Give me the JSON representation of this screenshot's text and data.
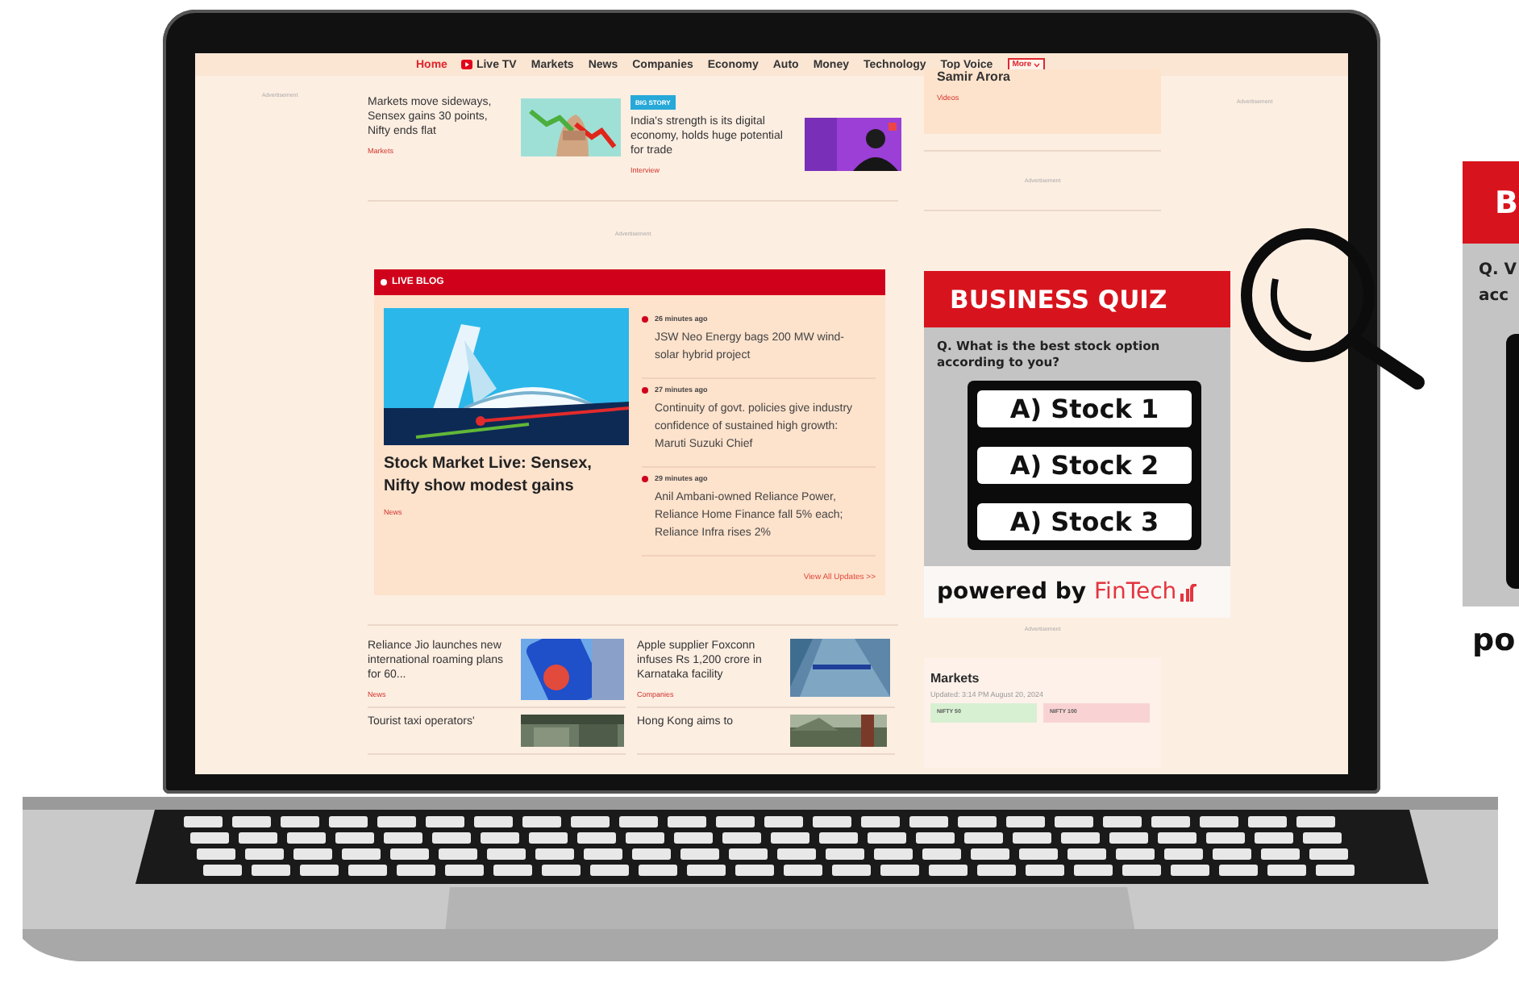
{
  "nav": {
    "items": [
      {
        "label": "Home",
        "selected": true,
        "kind": "text"
      },
      {
        "label": "Live TV",
        "selected": false,
        "kind": "live"
      },
      {
        "label": "Markets",
        "selected": false,
        "kind": "text"
      },
      {
        "label": "News",
        "selected": false,
        "kind": "text"
      },
      {
        "label": "Companies",
        "selected": false,
        "kind": "text"
      },
      {
        "label": "Economy",
        "selected": false,
        "kind": "text"
      },
      {
        "label": "Auto",
        "selected": false,
        "kind": "text"
      },
      {
        "label": "Money",
        "selected": false,
        "kind": "text"
      },
      {
        "label": "Technology",
        "selected": false,
        "kind": "text"
      },
      {
        "label": "Top Voice",
        "selected": false,
        "kind": "text"
      }
    ],
    "more": "More"
  },
  "ads": [
    "Advertisement",
    "Advertisement",
    "Advertisement",
    "Advertisement",
    "Advertisement"
  ],
  "top_stories": [
    {
      "headline": "Markets move sideways, Sensex gains 30 points, Nifty ends flat",
      "section": "Markets"
    },
    {
      "badge": "BIG STORY",
      "headline": "India's strength is its digital economy, holds huge potential for trade",
      "section": "Interview"
    }
  ],
  "side_card": {
    "title": "Samir Arora",
    "section": "Videos"
  },
  "live_blog": {
    "label": "LIVE BLOG",
    "headline": "Stock Market Live: Sensex, Nifty show modest gains",
    "section": "News",
    "updates": [
      {
        "time": "26 minutes ago",
        "text": "JSW Neo Energy bags 200 MW wind-solar hybrid project"
      },
      {
        "time": "27 minutes ago",
        "text": "Continuity of govt. policies give industry confidence of sustained high growth: Maruti Suzuki Chief"
      },
      {
        "time": "29 minutes ago",
        "text": "Anil Ambani-owned Reliance Power, Reliance Home Finance fall 5% each; Reliance Infra rises 2%"
      }
    ],
    "link": "View All Updates >>"
  },
  "more_stories": [
    {
      "headline": "Reliance Jio launches new international roaming plans for 60...",
      "section": "News"
    },
    {
      "headline": "Apple supplier Foxconn infuses Rs 1,200 crore in Karnataka facility",
      "section": "Companies"
    },
    {
      "headline": "Tourist taxi operators'"
    },
    {
      "headline": "Hong Kong aims to"
    }
  ],
  "quiz": {
    "title": "BUSINESS QUIZ",
    "question": "Q. What is the best stock option according to you?",
    "options": [
      "A) Stock 1",
      "A) Stock 2",
      "A) Stock 3"
    ],
    "powered_by": "powered by",
    "brand": "FinTech"
  },
  "markets": {
    "title": "Markets",
    "updated": "Updated: 3:14 PM August 20, 2024",
    "indices": [
      {
        "name": "NIFTY 50",
        "color": "#d8f0d2"
      },
      {
        "name": "NIFTY 100",
        "color": "#f9d3d3"
      }
    ]
  },
  "zoomed_quiz": {
    "title": "B",
    "question_lines": [
      "Q. V",
      "acc"
    ],
    "powered_by": "po"
  }
}
